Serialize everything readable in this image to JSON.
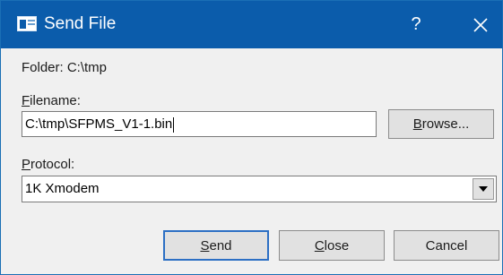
{
  "window": {
    "title": "Send File",
    "help_glyph": "?",
    "icons": {
      "app": "send-file-app-icon",
      "close": "close-icon"
    },
    "colors": {
      "titlebar": "#0b5cab",
      "body": "#f0f0f0",
      "default_button_border": "#2c6fc4"
    }
  },
  "form": {
    "folder_label": "Folder: C:\\tmp",
    "filename": {
      "label_prefix": "F",
      "label_rest": "ilename:",
      "value": "C:\\tmp\\SFPMS_V1-1.bin"
    },
    "browse": {
      "mnemonic": "B",
      "rest": "rowse..."
    },
    "protocol": {
      "label_prefix": "P",
      "label_rest": "rotocol:",
      "selected": "1K Xmodem"
    }
  },
  "buttons": {
    "send": {
      "mnemonic": "S",
      "rest": "end"
    },
    "close": {
      "mnemonic": "C",
      "rest": "lose"
    },
    "cancel": {
      "label": "Cancel"
    }
  }
}
